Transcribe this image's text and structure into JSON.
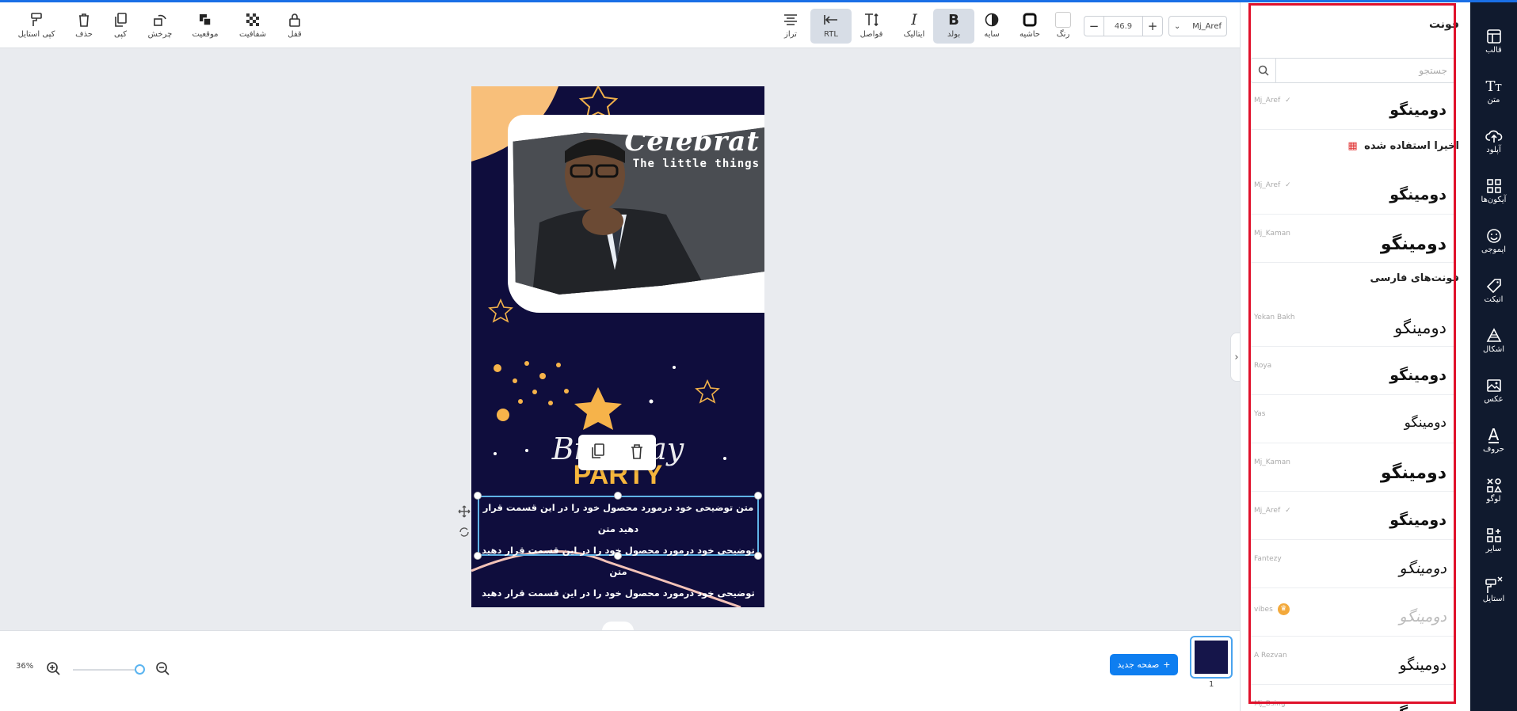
{
  "toolbar": {
    "left_tools": [
      {
        "label": "کپی استایل",
        "icon": "paint-roller-icon"
      },
      {
        "label": "حذف",
        "icon": "trash-icon"
      },
      {
        "label": "کپی",
        "icon": "copy-icon"
      },
      {
        "label": "چرخش",
        "icon": "rotate-icon"
      },
      {
        "label": "موقعیت",
        "icon": "layers-icon"
      },
      {
        "label": "شفافیت",
        "icon": "transparency-icon"
      },
      {
        "label": "قفل",
        "icon": "lock-icon"
      }
    ],
    "right_tools": [
      {
        "label": "تراز",
        "icon": "align-icon"
      },
      {
        "label": "RTL",
        "icon": "rtl-icon",
        "active": true
      },
      {
        "label": "فواصل",
        "icon": "spacing-icon"
      },
      {
        "label": "ایتالیک",
        "icon": "italic-icon"
      },
      {
        "label": "بولد",
        "icon": "bold-icon",
        "active": true
      },
      {
        "label": "سایه",
        "icon": "shadow-icon"
      },
      {
        "label": "حاشیه",
        "icon": "border-icon"
      },
      {
        "label": "رنگ",
        "icon": "color-swatch-icon"
      }
    ],
    "font_size": "46.9",
    "font_size_minus": "−",
    "font_size_plus": "+",
    "font_family": "Mj_Aref"
  },
  "design": {
    "headline": "Celebrat",
    "subline": "The little things",
    "birthday": "Birthday",
    "party": "PARTY",
    "body_lines": [
      "متن توضیحی خود درمورد محصول خود را در این قسمت قرار دهید متن",
      "توضیحی خود درمورد محصول خود را در این قسمت قرار دهید متن",
      "توضیحی خود درمورد محصول خود را در این قسمت قرار دهید"
    ]
  },
  "bottom": {
    "zoom": "36%",
    "zoom_level": 0.36,
    "new_page": "صفحه جدید",
    "page_number": "1"
  },
  "panel": {
    "title": "فونت",
    "search_placeholder": "جستجو",
    "recent_heading": "اخیرا استفاده شده",
    "persian_heading": "فونت‌های فارسی",
    "preview_text": "دومینگو",
    "recent": [
      {
        "name": "Mj_Aref",
        "checked": true
      }
    ],
    "fonts_top": [
      {
        "name": "Mj_Aref",
        "checked": true
      },
      {
        "name": "Mj_Kaman",
        "checked": false
      }
    ],
    "fonts": [
      {
        "name": "Yekan Bakh"
      },
      {
        "name": "Roya"
      },
      {
        "name": "Yas"
      },
      {
        "name": "Mj_Kaman"
      },
      {
        "name": "Mj_Aref",
        "checked": true
      },
      {
        "name": "Fantezy"
      },
      {
        "name": "vibes",
        "premium": true
      },
      {
        "name": "A Rezvan"
      },
      {
        "name": "Mj_Bsing"
      }
    ]
  },
  "rightbar": {
    "items": [
      {
        "label": "قالب",
        "icon": "template-icon"
      },
      {
        "label": "متن",
        "icon": "text-icon"
      },
      {
        "label": "آپلود",
        "icon": "upload-icon"
      },
      {
        "label": "آیکون‌ها",
        "icon": "icons-grid-icon"
      },
      {
        "label": "ایموجی",
        "icon": "emoji-icon"
      },
      {
        "label": "اتیکت",
        "icon": "tag-icon"
      },
      {
        "label": "اشکال",
        "icon": "shapes-icon"
      },
      {
        "label": "عکس",
        "icon": "image-icon"
      },
      {
        "label": "حروف",
        "icon": "letters-icon"
      },
      {
        "label": "لوگو",
        "icon": "logo-icon"
      },
      {
        "label": "سایر",
        "icon": "more-icon"
      },
      {
        "label": "استایل",
        "icon": "style-icon"
      }
    ]
  },
  "colors": {
    "accent": "#1a6fe6",
    "sidebar": "#101a2e",
    "highlight_frame": "#e0112b",
    "design_bg": "#0f0d3d",
    "party_gold": "#f6b63c"
  }
}
